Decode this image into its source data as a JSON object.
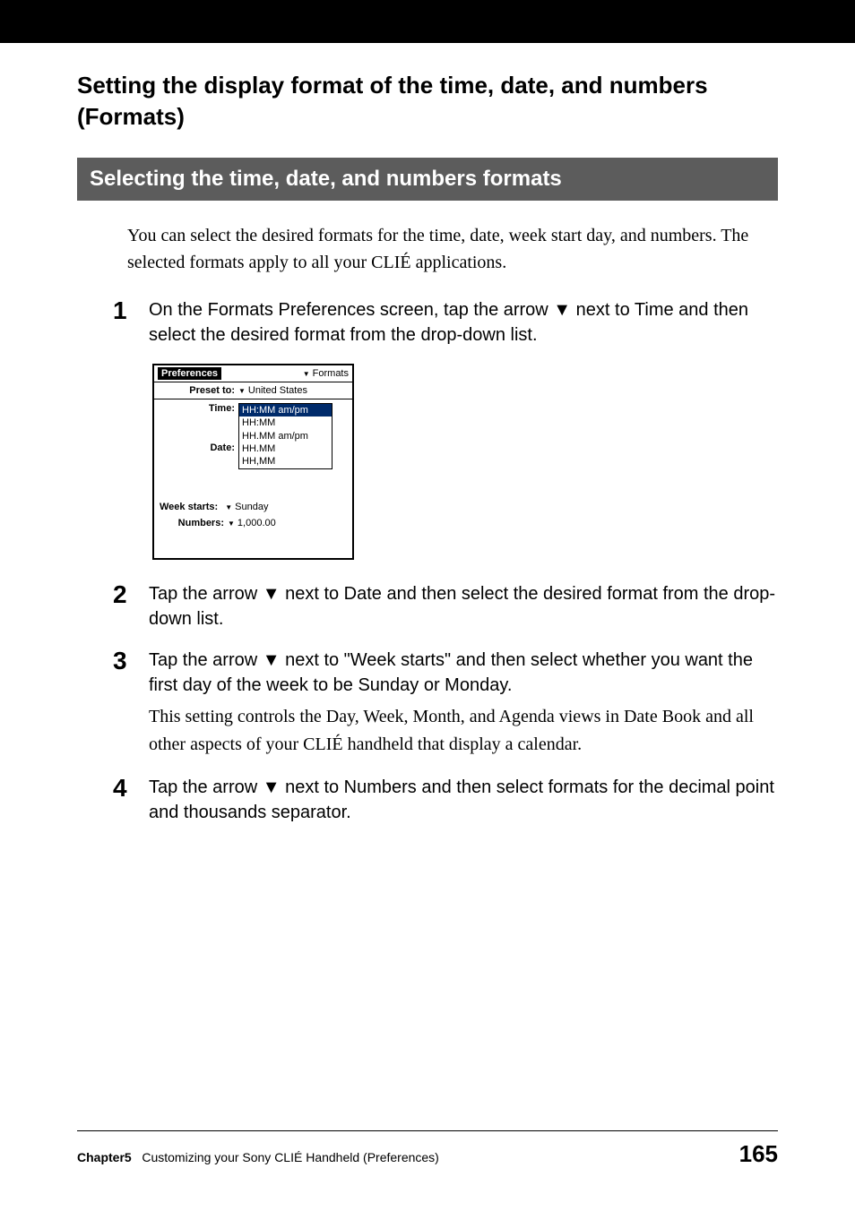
{
  "heading": "Setting the display format of the time, date, and numbers (Formats)",
  "subheading": "Selecting the time, date, and numbers formats",
  "intro": "You can select the desired formats for the time, date, week start day, and numbers. The selected formats apply to all your CLIÉ applications.",
  "steps": {
    "s1": {
      "num": "1",
      "text": "On the Formats Preferences screen, tap the arrow ▼ next to Time and then select the desired format from the drop-down list."
    },
    "s2": {
      "num": "2",
      "text": "Tap the arrow ▼ next to Date and then select the desired format from the drop-down list."
    },
    "s3": {
      "num": "3",
      "text": "Tap the arrow ▼ next to \"Week starts\" and then select whether you want the first day of the week to be Sunday or Monday.",
      "note": "This setting controls the Day, Week, Month, and Agenda views in Date Book and all other aspects of your CLIÉ handheld that display a calendar."
    },
    "s4": {
      "num": "4",
      "text": "Tap the arrow ▼ next to Numbers and then select formats for the decimal point and thousands separator."
    }
  },
  "palm": {
    "title": "Preferences",
    "category": "Formats",
    "preset_label": "Preset to:",
    "preset_value": "United States",
    "time_label": "Time:",
    "date_label": "Date:",
    "time_options": [
      "HH:MM am/pm",
      "HH:MM",
      "HH.MM am/pm",
      "HH.MM",
      "HH,MM"
    ],
    "week_label": "Week starts:",
    "week_value": "Sunday",
    "numbers_label": "Numbers:",
    "numbers_value": "1,000.00"
  },
  "footer": {
    "chapter": "Chapter5",
    "title": "Customizing your Sony CLIÉ Handheld (Preferences)",
    "page": "165"
  }
}
